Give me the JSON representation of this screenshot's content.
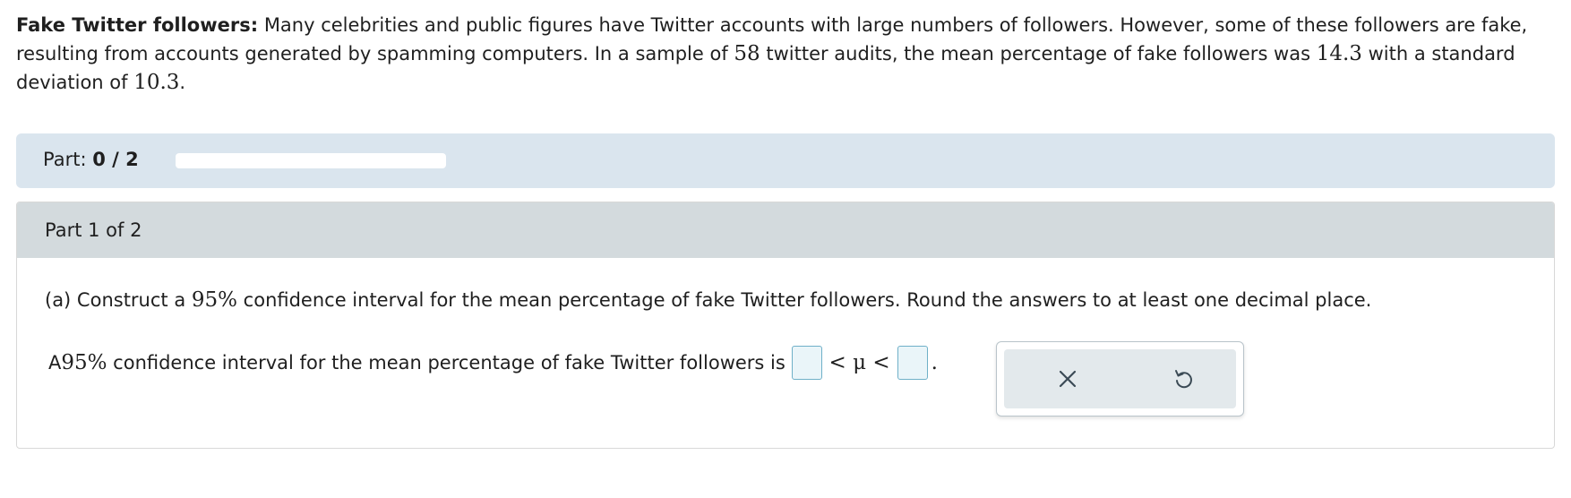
{
  "intro": {
    "title": "Fake Twitter followers:",
    "text_1": " Many celebrities and public figures have Twitter accounts with large numbers of followers. However, some of these followers are fake, resulting from accounts generated by spamming computers. In a sample of ",
    "sample_size": "58",
    "text_2": " twitter audits, the mean percentage of fake followers was ",
    "mean": "14.3",
    "text_3": " with a standard deviation of ",
    "std_dev": "10.3",
    "text_4": "."
  },
  "progress": {
    "label": "Part:",
    "count": "0 / 2",
    "completed_fraction": 0
  },
  "part": {
    "header": "Part 1 of 2",
    "question_prefix": "(a) Construct a ",
    "question_confidence": "95%",
    "question_suffix": " confidence interval for the mean percentage of fake Twitter followers. Round the answers to at least one decimal place.",
    "answer_prefix": "A ",
    "answer_confidence": "95%",
    "answer_middle": " confidence interval for the mean percentage of fake Twitter followers is ",
    "lower_bound_value": "",
    "inequality": "< μ <",
    "upper_bound_value": "",
    "answer_end": "."
  },
  "tools": {
    "clear_icon": "close-icon",
    "undo_icon": "undo-icon"
  },
  "colors": {
    "progress_bar_bg": "#dae5ee",
    "card_header_bg": "#d3dadd",
    "input_border": "#6fb0c8",
    "input_bg": "#eaf5f9",
    "icon_color": "#3b4a55"
  }
}
